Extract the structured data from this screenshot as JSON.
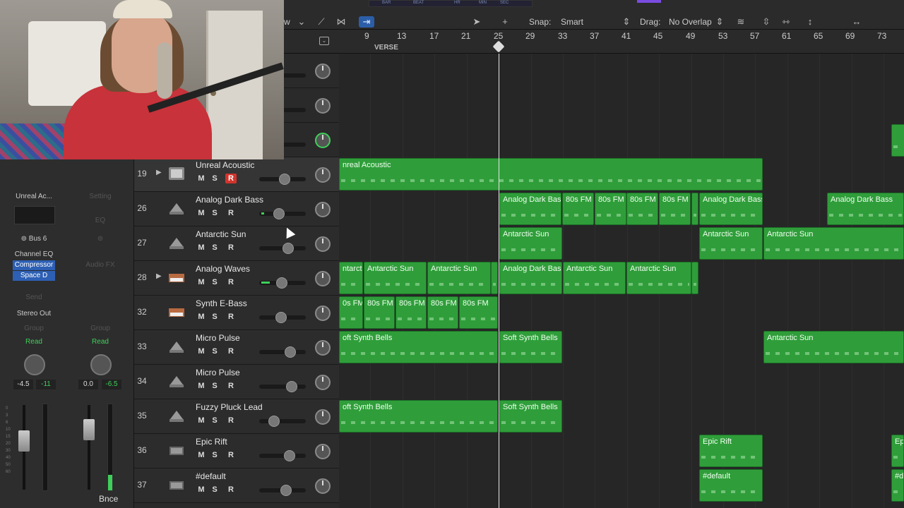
{
  "toolbar": {
    "lcd": [
      "BAR",
      "BEAT",
      "HR",
      "MIN",
      "SEC"
    ],
    "view_label": "w",
    "snap_label": "Snap:",
    "snap_value": "Smart",
    "drag_label": "Drag:",
    "drag_value": "No Overlap"
  },
  "ruler": {
    "bars": [
      "9",
      "13",
      "17",
      "21",
      "25",
      "29",
      "33",
      "37",
      "41",
      "45",
      "49",
      "53",
      "57",
      "61",
      "65",
      "69",
      "73"
    ],
    "marker": "VERSE"
  },
  "inspector": {
    "strip1": {
      "name": "Unreal Ac...",
      "bus": "Bus 6",
      "plugins": [
        "Channel EQ",
        "Compressor",
        "Space D"
      ],
      "send": "Send",
      "output": "Stereo Out",
      "group": "Group",
      "automation": "Read",
      "volume": "-4.5",
      "peak": "-11"
    },
    "strip2": {
      "setting": "Setting",
      "eq": "EQ",
      "audio_fx": "Audio FX",
      "group": "Group",
      "automation": "Read",
      "volume": "0.0",
      "peak": "-6.5",
      "label": "Bnce"
    }
  },
  "tracks": [
    {
      "num": "19",
      "name": "Unreal Acoustic",
      "m": "M",
      "s": "S",
      "r": "R"
    },
    {
      "num": "26",
      "name": "Analog Dark Bass",
      "m": "M",
      "s": "S",
      "r": "R"
    },
    {
      "num": "27",
      "name": "Antarctic Sun",
      "m": "M",
      "s": "S",
      "r": "R"
    },
    {
      "num": "28",
      "name": "Analog Waves",
      "m": "M",
      "s": "S",
      "r": "R"
    },
    {
      "num": "32",
      "name": "Synth E-Bass",
      "m": "M",
      "s": "S",
      "r": "R"
    },
    {
      "num": "33",
      "name": "Micro Pulse",
      "m": "M",
      "s": "S",
      "r": "R"
    },
    {
      "num": "34",
      "name": "Micro Pulse",
      "m": "M",
      "s": "S",
      "r": "R"
    },
    {
      "num": "35",
      "name": "Fuzzy Pluck Lead",
      "m": "M",
      "s": "S",
      "r": "R"
    },
    {
      "num": "36",
      "name": "Epic Rift",
      "m": "M",
      "s": "S",
      "r": "R"
    },
    {
      "num": "37",
      "name": "#default",
      "m": "M",
      "s": "S",
      "r": "R"
    }
  ],
  "regions": {
    "unreal": "nreal Acoustic",
    "adb1": "Analog Dark Bass",
    "fm1": "80s FM",
    "fm2": "80s FM",
    "fm3": "80s FM",
    "fm4": "80s FM",
    "adb2": "Analog Dark Bass",
    "adb3": "Analog Dark Bass",
    "as1": "Antarctic Sun",
    "as2": "Antarctic Sun",
    "as3": "Antarctic Sun",
    "w1": "ntarcti",
    "w2": "Antarctic Sun",
    "w3": "Antarctic Sun",
    "w4": "Analog Dark Bass",
    "w5": "Antarctic Sun",
    "w6": "Antarctic Sun",
    "e1": "0s FM",
    "e2": "80s FM",
    "e3": "80s FM",
    "e4": "80s FM",
    "e5": "80s FM",
    "sb1": "oft Synth Bells",
    "sb2": "Soft Synth Bells",
    "as4": "Antarctic Sun",
    "sb3": "oft Synth Bells",
    "sb4": "Soft Synth Bells",
    "er1": "Epic Rift",
    "er2": "Ep",
    "d1": "#default",
    "d2": "#d"
  }
}
